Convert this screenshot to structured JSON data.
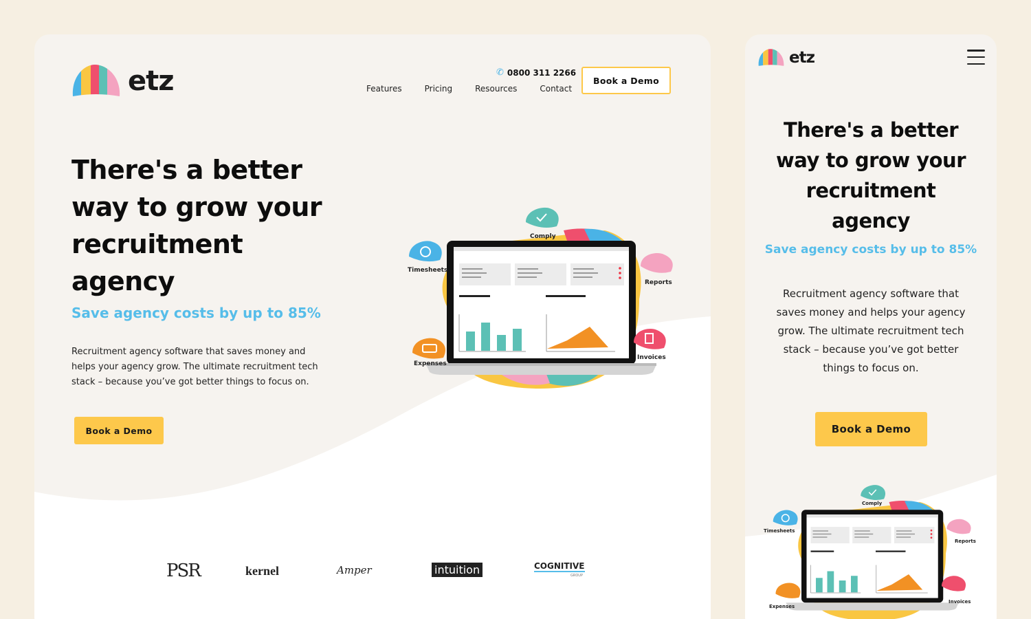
{
  "brand": {
    "name": "etz"
  },
  "header": {
    "phone": "0800 311 2266",
    "nav": [
      "Features",
      "Pricing",
      "Resources",
      "Contact"
    ],
    "cta_label": "Book a Demo"
  },
  "hero": {
    "title_lines": [
      "There's a better",
      "way to grow your",
      "recruitment",
      "agency"
    ],
    "subtitle": "Save agency costs by up to 85%",
    "body_lines_desktop": [
      "Recruitment agency software that saves money and",
      "helps your agency grow. The ultimate recruitment tech",
      "stack – because you’ve got better things to focus on."
    ],
    "body_lines_mobile": [
      "Recruitment agency software that",
      "saves money and helps your agency",
      "grow. The ultimate recruitment tech",
      "stack – because you’ve got better",
      "things to focus on."
    ],
    "cta_label": "Book a Demo"
  },
  "illustration": {
    "badges": [
      "Comply",
      "Timesheets",
      "Reports",
      "Expenses",
      "Invoices"
    ]
  },
  "clients": [
    "PSR",
    "kernel",
    "Amper",
    "intuition",
    "COGNITIVE",
    "GROUP"
  ],
  "colors": {
    "background": "#f6efe2",
    "card": "#f6f3ef",
    "accent_yellow": "#fdc84b",
    "accent_blue": "#56bde9",
    "teal": "#5cc0b5",
    "orange": "#f29124"
  }
}
